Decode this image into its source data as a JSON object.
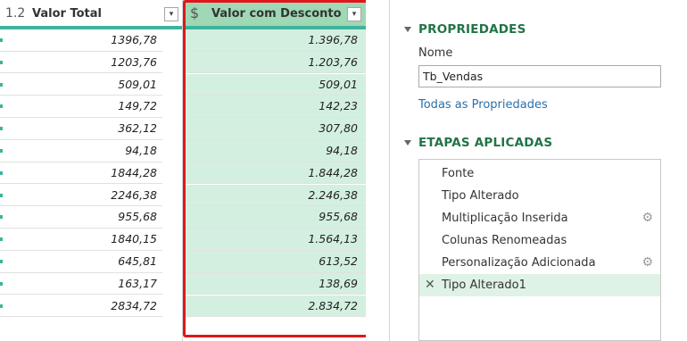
{
  "grid": {
    "col_total": {
      "type_glyph": "1.2",
      "title": "Valor Total",
      "filter": "▾"
    },
    "col_desc": {
      "type_glyph": "$",
      "title": "Valor com Desconto",
      "filter": "▾"
    },
    "rows": [
      {
        "total": "1396,78",
        "desc": "1.396,78"
      },
      {
        "total": "1203,76",
        "desc": "1.203,76"
      },
      {
        "total": "509,01",
        "desc": "509,01"
      },
      {
        "total": "149,72",
        "desc": "142,23"
      },
      {
        "total": "362,12",
        "desc": "307,80"
      },
      {
        "total": "94,18",
        "desc": "94,18"
      },
      {
        "total": "1844,28",
        "desc": "1.844,28"
      },
      {
        "total": "2246,38",
        "desc": "2.246,38"
      },
      {
        "total": "955,68",
        "desc": "955,68"
      },
      {
        "total": "1840,15",
        "desc": "1.564,13"
      },
      {
        "total": "645,81",
        "desc": "613,52"
      },
      {
        "total": "163,17",
        "desc": "138,69"
      },
      {
        "total": "2834,72",
        "desc": "2.834,72"
      }
    ],
    "scroll_up_glyph": "∧"
  },
  "panel": {
    "properties_title": "PROPRIEDADES",
    "name_label": "Nome",
    "name_value": "Tb_Vendas",
    "all_properties_link": "Todas as Propriedades",
    "steps_title": "ETAPAS APLICADAS",
    "steps": [
      {
        "label": "Fonte",
        "gear": false,
        "selected": false
      },
      {
        "label": "Tipo Alterado",
        "gear": false,
        "selected": false
      },
      {
        "label": "Multiplicação Inserida",
        "gear": true,
        "selected": false
      },
      {
        "label": "Colunas Renomeadas",
        "gear": false,
        "selected": false
      },
      {
        "label": "Personalização Adicionada",
        "gear": true,
        "selected": false
      },
      {
        "label": "Tipo Alterado1",
        "gear": false,
        "selected": true
      }
    ],
    "delete_glyph": "✕",
    "gear_glyph": "⚙"
  },
  "colors": {
    "accent_green": "#3fb39d",
    "selected_column_bg": "#d3efe0",
    "highlight_red": "#e0161c",
    "section_title_green": "#227447",
    "link_blue": "#2b6fab"
  }
}
